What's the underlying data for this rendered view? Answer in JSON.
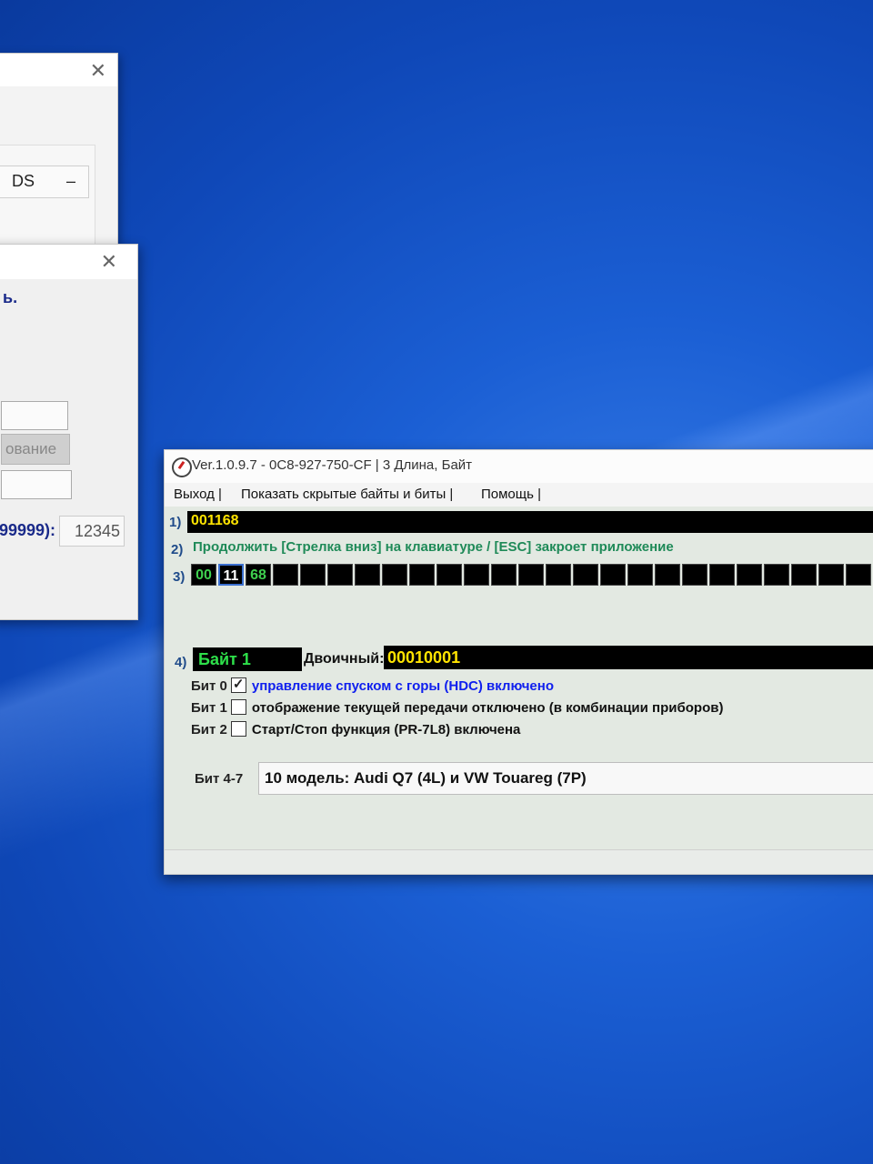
{
  "background_windows": {
    "top": {
      "title_fragment": ")",
      "field_text": "DS",
      "field_dash": "–"
    },
    "middle": {
      "title_fragment": "",
      "blue_text": "ь.",
      "button_fragment": "ование",
      "range_label": "99999):",
      "value": "12345"
    }
  },
  "main_window": {
    "title": "Ver.1.0.9.7 -   0C8-927-750-CF | 3 Длина, Байт",
    "menu": {
      "exit": "Выход |",
      "show_hidden": "Показать скрытые байты и биты |",
      "help": "Помощь |"
    },
    "row1": {
      "num": "1)",
      "value": "001168"
    },
    "row2": {
      "num": "2)",
      "text": "Продолжить [Стрелка вниз] на клавиатуре / [ESC] закроет приложение"
    },
    "row3": {
      "num": "3)",
      "bytes": [
        "00",
        "11",
        "68",
        "",
        "",
        "",
        "",
        "",
        "",
        "",
        "",
        "",
        "",
        "",
        "",
        "",
        "",
        "",
        "",
        "",
        "",
        "",
        "",
        "",
        ""
      ]
    },
    "row4": {
      "num": "4)",
      "byte_label": "Байт 1",
      "binary_label": "Двоичный:",
      "binary_value": "00010001"
    },
    "bits": [
      {
        "label": "Бит 0",
        "checked": true,
        "description": "управление спуском с горы (HDC) включено"
      },
      {
        "label": "Бит 1",
        "checked": false,
        "description": "отображение текущей передачи отключено (в комбинации приборов)"
      },
      {
        "label": "Бит 2",
        "checked": false,
        "description": "Старт/Стоп функция (PR-7L8) включена"
      }
    ],
    "bit47": {
      "label": "Бит 4-7",
      "selected": "10 модель: Audi Q7 (4L) и VW Touareg (7P)"
    }
  }
}
